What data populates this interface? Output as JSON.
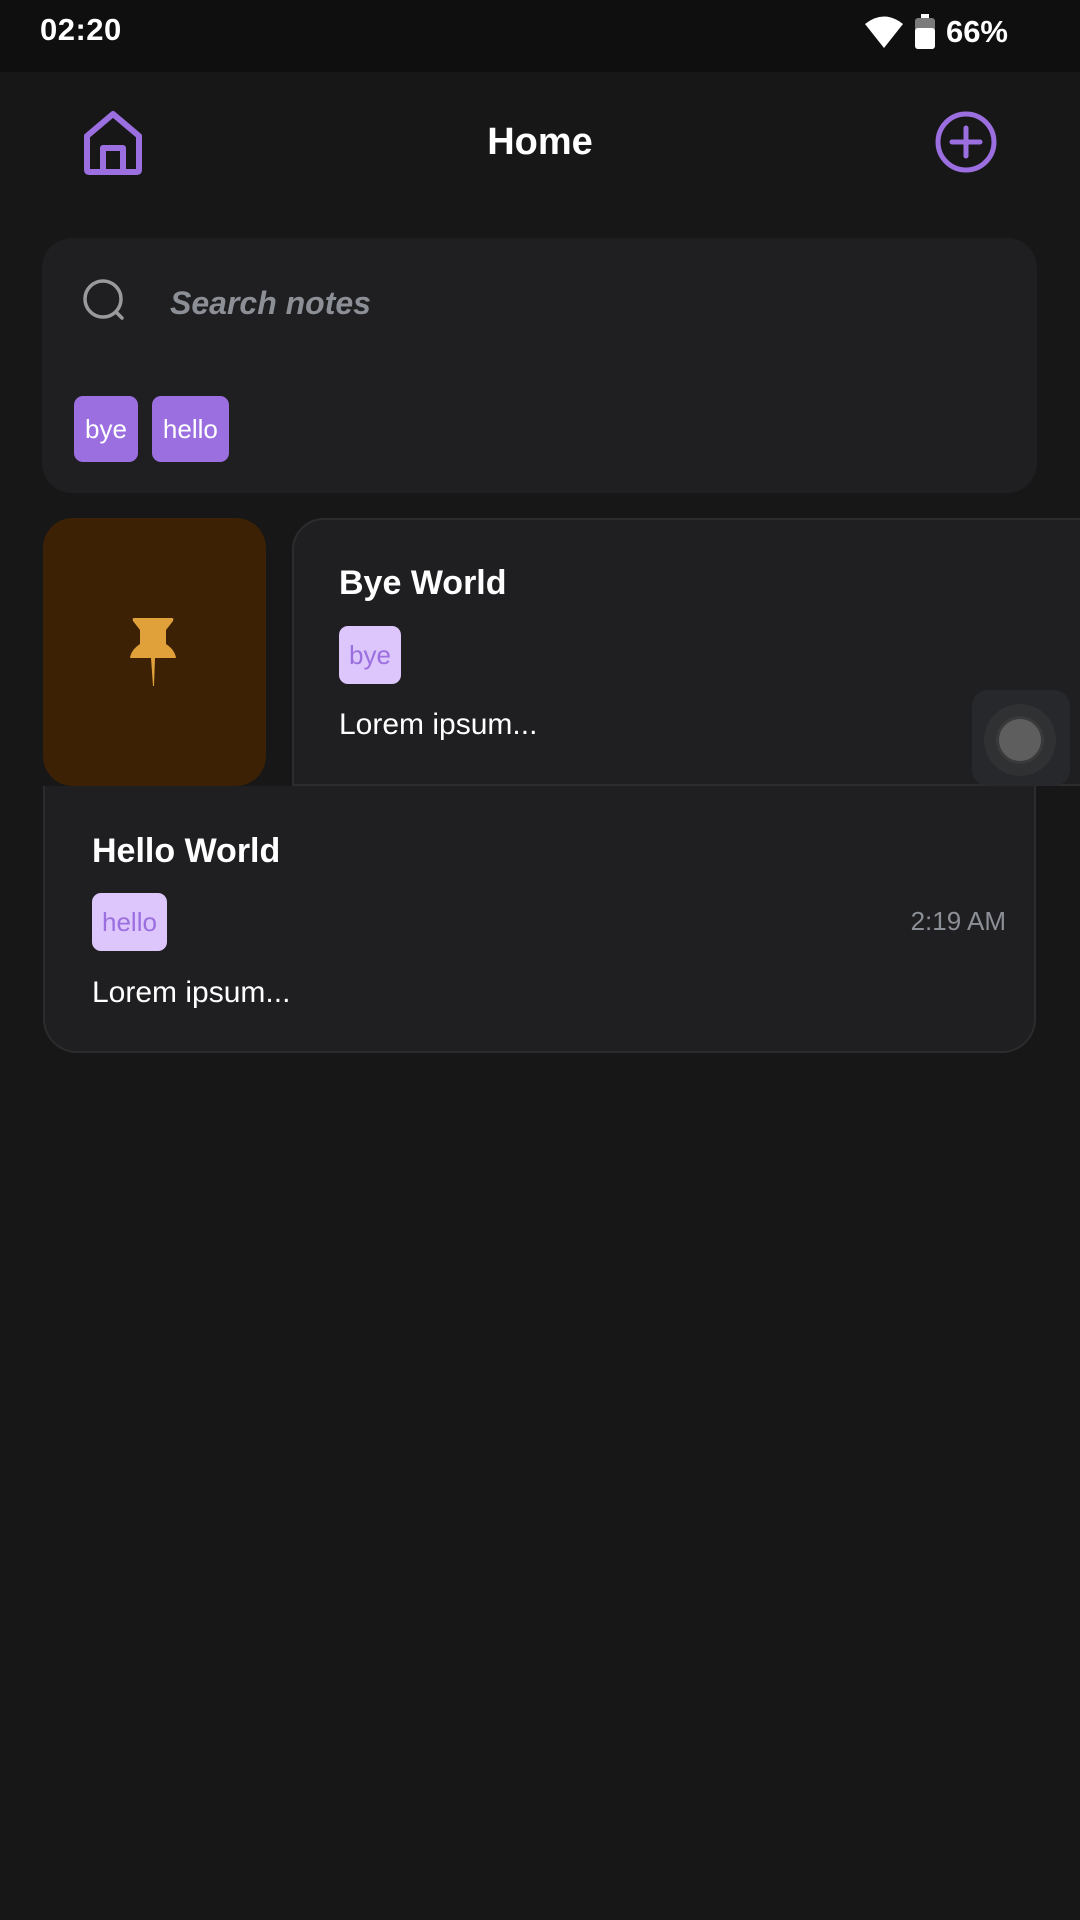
{
  "status_bar": {
    "time": "02:20",
    "battery": "66%",
    "wifi_icon": "wifi-icon",
    "battery_icon": "battery-icon"
  },
  "header": {
    "title": "Home",
    "left_icon": "home-icon",
    "right_icon": "add-circle-icon"
  },
  "search": {
    "placeholder": "Search notes",
    "value": "",
    "icon": "search-icon"
  },
  "filter_tags": [
    "bye",
    "hello"
  ],
  "notes": [
    {
      "title": "Bye World",
      "tag": "bye",
      "body": "Lorem ipsum...",
      "pinned_action_icon": "pin-icon"
    },
    {
      "title": "Hello World",
      "tag": "hello",
      "body": "Lorem ipsum...",
      "time": "2:19 AM"
    }
  ],
  "colors": {
    "accent": "#9b6fe0",
    "background": "#171717",
    "card": "#1f1f21",
    "pin_bg": "#3c2105",
    "pin": "#e0a13a",
    "tag_light": "#dcc6fb"
  }
}
